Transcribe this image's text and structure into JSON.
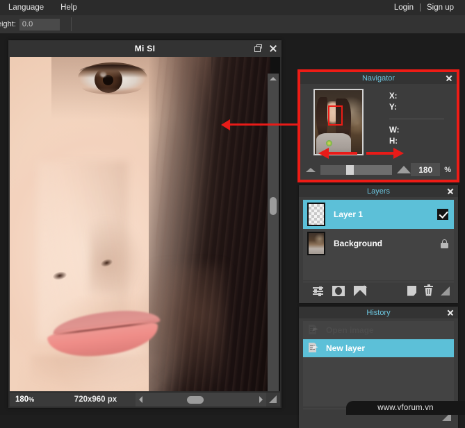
{
  "menubar": {
    "items": [
      {
        "label": "Language"
      },
      {
        "label": "Help"
      }
    ],
    "login_label": "Login",
    "separator": "|",
    "signup_label": "Sign up"
  },
  "toolbar": {
    "height_label": "eight:",
    "height_value": "0.0"
  },
  "canvas_window": {
    "title": "Mi SI",
    "restore_icon": "restore-icon",
    "close_icon": "close-icon",
    "status": {
      "zoom": "180",
      "zoom_unit": "%",
      "dimensions": "720x960 px"
    }
  },
  "navigator": {
    "title": "Navigator",
    "close_icon": "close-icon",
    "info": {
      "x_label": "X:",
      "y_label": "Y:",
      "w_label": "W:",
      "h_label": "H:"
    },
    "zoom_out_icon": "zoom-out-triangle-icon",
    "zoom_in_icon": "zoom-in-triangle-icon",
    "zoom_value": "180",
    "zoom_unit": "%"
  },
  "layers": {
    "title": "Layers",
    "close_icon": "close-icon",
    "rows": [
      {
        "name": "Layer 1",
        "selected": true,
        "thumb": "transparent-checker",
        "right_icon": "visibility-checkbox"
      },
      {
        "name": "Background",
        "selected": false,
        "thumb": "photo",
        "right_icon": "lock-icon"
      }
    ],
    "toolbar_icons": [
      "layer-adjust-icon",
      "layer-mask-icon",
      "add-mask-icon",
      "duplicate-layer-icon",
      "delete-layer-icon",
      "resize-grip-icon"
    ]
  },
  "history": {
    "title": "History",
    "close_icon": "close-icon",
    "rows": [
      {
        "name": "Open image",
        "selected": false
      },
      {
        "name": "New layer",
        "selected": true
      }
    ],
    "resize_grip_icon": "resize-grip-icon"
  },
  "watermark": {
    "text": "www.vforum.vn"
  },
  "colors": {
    "accent": "#5cc0d8",
    "panel_title_text": "#6cc4dd",
    "annotation_red": "#ee1c16",
    "panel_bg": "#3c3c3c",
    "window_bg": "#2e2e2e",
    "menubar_bg": "#2b2b2b"
  }
}
